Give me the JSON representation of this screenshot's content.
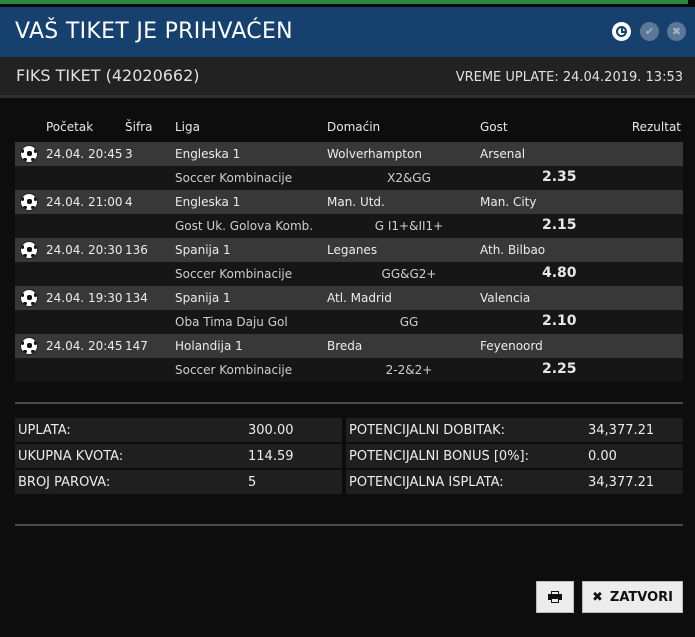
{
  "header": {
    "title": "VAŠ TIKET JE PRIHVAĆEN"
  },
  "ticket": {
    "id_label": "FIKS TIKET (42020662)",
    "time_label": "VREME UPLATE: 24.04.2019. 13:53"
  },
  "table": {
    "columns": {
      "start": "Početak",
      "code": "Šifra",
      "league": "Liga",
      "home": "Domaćin",
      "away": "Gost",
      "result": "Rezultat"
    },
    "rows": [
      {
        "start": "24.04. 20:45",
        "code": "3",
        "league": "Engleska 1",
        "home": "Wolverhampton",
        "away": "Arsenal",
        "bet_type": "Soccer Kombinacije",
        "pick": "X2&GG",
        "odd": "2.35"
      },
      {
        "start": "24.04. 21:00",
        "code": "4",
        "league": "Engleska 1",
        "home": "Man. Utd.",
        "away": "Man. City",
        "bet_type": "Gost Uk. Golova Komb.",
        "pick": "G I1+&II1+",
        "odd": "2.15"
      },
      {
        "start": "24.04. 20:30",
        "code": "136",
        "league": "Spanija 1",
        "home": "Leganes",
        "away": "Ath. Bilbao",
        "bet_type": "Soccer Kombinacije",
        "pick": "GG&G2+",
        "odd": "4.80"
      },
      {
        "start": "24.04. 19:30",
        "code": "134",
        "league": "Spanija 1",
        "home": "Atl. Madrid",
        "away": "Valencia",
        "bet_type": "Oba Tima Daju Gol",
        "pick": "GG",
        "odd": "2.10"
      },
      {
        "start": "24.04. 20:45",
        "code": "147",
        "league": "Holandija 1",
        "home": "Breda",
        "away": "Feyenoord",
        "bet_type": "Soccer Kombinacije",
        "pick": "2-2&2+",
        "odd": "2.25"
      }
    ]
  },
  "summary": {
    "stake_label": "UPLATA:",
    "stake": "300.00",
    "total_odds_label": "UKUPNA KVOTA:",
    "total_odds": "114.59",
    "pairs_label": "BROJ PAROVA:",
    "pairs": "5",
    "potential_win_label": "POTENCIJALNI DOBITAK:",
    "potential_win": "34,377.21",
    "bonus_label": "POTENCIJALNI BONUS [0%]:",
    "bonus": "0.00",
    "payout_label": "POTENCIJALNA ISPLATA:",
    "payout": "34,377.21"
  },
  "buttons": {
    "close_label": "ZATVORI"
  },
  "icons": {
    "clock": "clock-icon",
    "check": "check-icon",
    "close": "close-icon",
    "ball": "soccer-ball-icon",
    "print": "printer-icon",
    "x": "x-icon"
  },
  "colors": {
    "header_bg": "#16416f",
    "body_bg": "#0d0d0d",
    "accent_green": "#2b8a3e"
  }
}
